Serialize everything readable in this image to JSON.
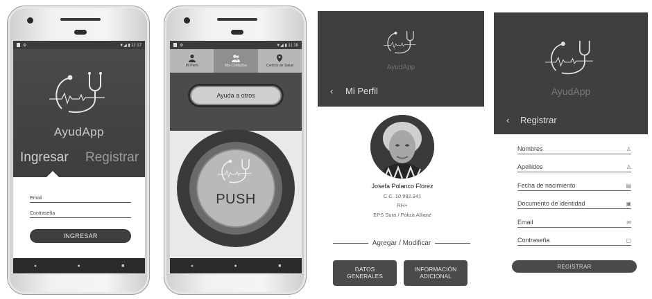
{
  "status_time_1": "11:17",
  "status_time_2": "11:18",
  "login": {
    "app_name": "AyudApp",
    "tab_login": "Ingresar",
    "tab_register": "Registrar",
    "email_label": "Email",
    "password_label": "Contraseña",
    "submit_label": "INGRESAR"
  },
  "push": {
    "tabs": [
      {
        "label": "Mi Perfil",
        "icon": "person-icon"
      },
      {
        "label": "Mis Contactos",
        "icon": "contacts-icon"
      },
      {
        "label": "Centros de Salud",
        "icon": "location-pin-icon"
      }
    ],
    "help_label": "Ayuda a otros",
    "push_label": "PUSH"
  },
  "profile": {
    "app_name": "AyudApp",
    "title": "Mi Perfil",
    "name": "Josefa Polanco Florez",
    "id_number": "C.C. 10.982.341",
    "blood_type": "RH+",
    "insurance": "EPS Sura / Póliza Allianz",
    "section_title": "Agregar / Modificar",
    "button_general": "DATOS\nGENERALES",
    "button_additional": "INFORMACIÓN\nADICIONAL"
  },
  "register": {
    "app_name": "AyudApp",
    "title": "Registrar",
    "fields": [
      {
        "label": "Nombres",
        "icon": "person-outline-icon"
      },
      {
        "label": "Apellidos",
        "icon": "person-outline-icon"
      },
      {
        "label": "Fecha de nacimiento",
        "icon": "calendar-icon"
      },
      {
        "label": "Documento de identidad",
        "icon": "id-card-icon"
      },
      {
        "label": "Email",
        "icon": "mail-icon"
      },
      {
        "label": "Contraseña",
        "icon": "lock-icon"
      }
    ],
    "submit_label": "REGISTRAR"
  },
  "nav": {
    "back": "◂",
    "home": "●",
    "recent": "■"
  },
  "colors": {
    "dark": "#3f3f3f",
    "medium": "#4a4a4a",
    "light": "#e9e9e9"
  }
}
